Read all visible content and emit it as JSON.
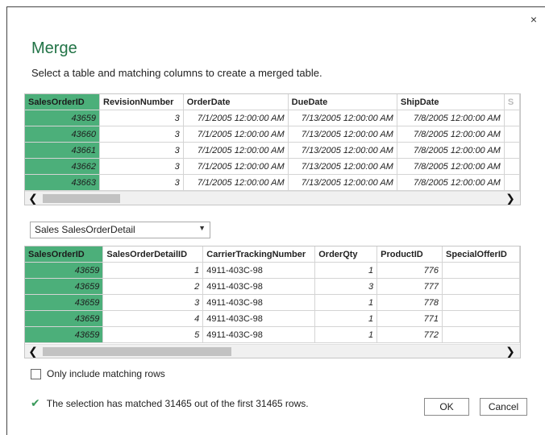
{
  "dialog": {
    "title": "Merge",
    "subtitle": "Select a table and matching columns to create a merged table.",
    "close_glyph": "×"
  },
  "top_table": {
    "columns": [
      "SalesOrderID",
      "RevisionNumber",
      "OrderDate",
      "DueDate",
      "ShipDate",
      "S"
    ],
    "rows": [
      [
        "43659",
        "3",
        "7/1/2005 12:00:00 AM",
        "7/13/2005 12:00:00 AM",
        "7/8/2005 12:00:00 AM"
      ],
      [
        "43660",
        "3",
        "7/1/2005 12:00:00 AM",
        "7/13/2005 12:00:00 AM",
        "7/8/2005 12:00:00 AM"
      ],
      [
        "43661",
        "3",
        "7/1/2005 12:00:00 AM",
        "7/13/2005 12:00:00 AM",
        "7/8/2005 12:00:00 AM"
      ],
      [
        "43662",
        "3",
        "7/1/2005 12:00:00 AM",
        "7/13/2005 12:00:00 AM",
        "7/8/2005 12:00:00 AM"
      ],
      [
        "43663",
        "3",
        "7/1/2005 12:00:00 AM",
        "7/13/2005 12:00:00 AM",
        "7/8/2005 12:00:00 AM"
      ]
    ],
    "selected_column": "SalesOrderID"
  },
  "dropdown": {
    "selected": "Sales SalesOrderDetail"
  },
  "bottom_table": {
    "columns": [
      "SalesOrderID",
      "SalesOrderDetailID",
      "CarrierTrackingNumber",
      "OrderQty",
      "ProductID",
      "SpecialOfferID"
    ],
    "rows": [
      [
        "43659",
        "1",
        "4911-403C-98",
        "1",
        "776",
        ""
      ],
      [
        "43659",
        "2",
        "4911-403C-98",
        "3",
        "777",
        ""
      ],
      [
        "43659",
        "3",
        "4911-403C-98",
        "1",
        "778",
        ""
      ],
      [
        "43659",
        "4",
        "4911-403C-98",
        "1",
        "771",
        ""
      ],
      [
        "43659",
        "5",
        "4911-403C-98",
        "1",
        "772",
        ""
      ]
    ],
    "selected_column": "SalesOrderID"
  },
  "scroll": {
    "left_arrow": "❮",
    "right_arrow": "❯"
  },
  "options": {
    "only_matching_label": "Only include matching rows",
    "only_matching_checked": false
  },
  "status": {
    "icon": "check-icon",
    "text": "The selection has matched 31465 out of the first 31465 rows."
  },
  "buttons": {
    "ok": "OK",
    "cancel": "Cancel"
  },
  "colors": {
    "accent": "#217346",
    "selected_column": "#4caf7a",
    "check": "#3a9a5b"
  }
}
